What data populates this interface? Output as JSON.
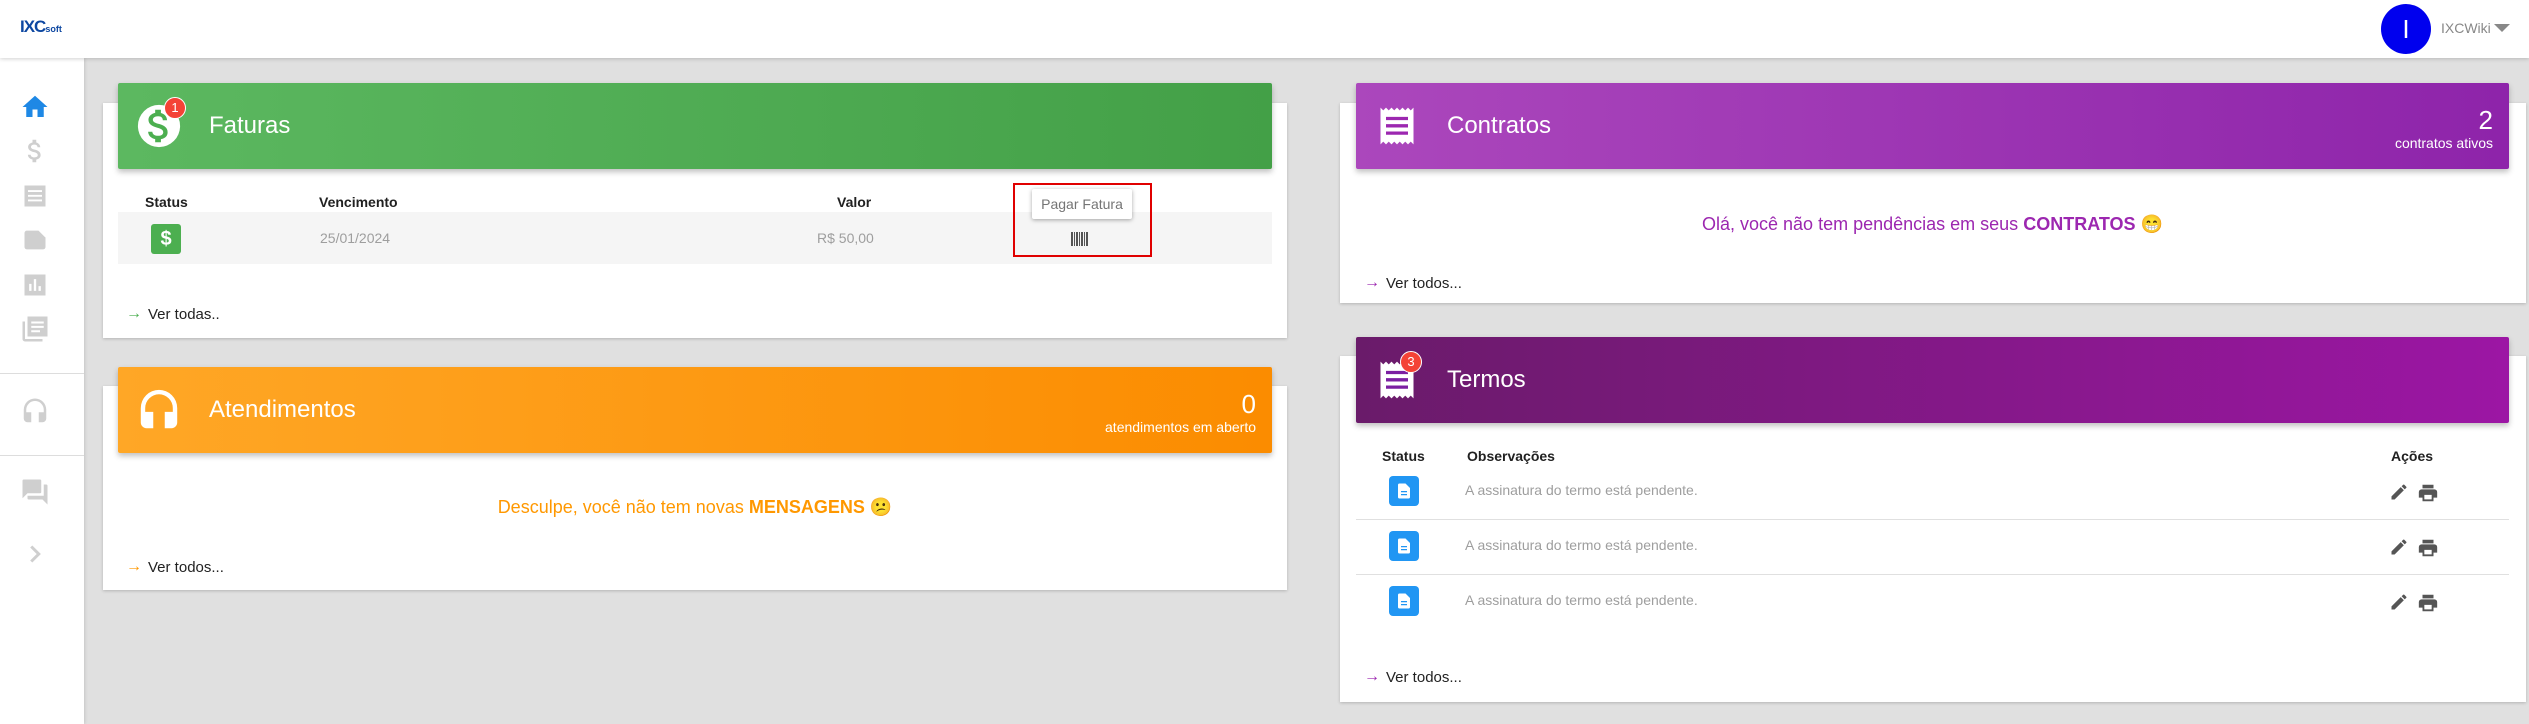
{
  "topbar": {
    "logo": "IXC",
    "logo_suffix": "soft",
    "avatar_initial": "I",
    "username": "IXCWiki"
  },
  "sidebar": {
    "items": [
      {
        "icon": "home-icon"
      },
      {
        "icon": "dollar-icon"
      },
      {
        "icon": "list-icon"
      },
      {
        "icon": "label-icon"
      },
      {
        "icon": "bar-chart-icon"
      },
      {
        "icon": "library-icon"
      },
      {
        "icon": "headset-icon"
      },
      {
        "icon": "forum-icon"
      },
      {
        "icon": "chevron-right-icon"
      }
    ]
  },
  "faturas": {
    "title": "Faturas",
    "badge": "1",
    "color": "#4caf50",
    "columns": {
      "status": "Status",
      "vencimento": "Vencimento",
      "valor": "Valor"
    },
    "rows": [
      {
        "vencimento": "25/01/2024",
        "valor": "R$ 50,00"
      }
    ],
    "tooltip": "Pagar Fatura",
    "see_all": "Ver todas.."
  },
  "atendimentos": {
    "title": "Atendimentos",
    "count": "0",
    "count_label": "atendimentos em aberto",
    "color": "#ff9800",
    "message_prefix": "Desculpe, você não tem novas",
    "message_bold": "MENSAGENS",
    "message_emoji": "😕",
    "see_all": "Ver todos..."
  },
  "contratos": {
    "title": "Contratos",
    "count": "2",
    "count_label": "contratos ativos",
    "color": "#9c27b0",
    "message_prefix": "Olá, você não tem pendências em seus",
    "message_bold": "CONTRATOS",
    "message_emoji": "😁",
    "see_all": "Ver todos..."
  },
  "termos": {
    "title": "Termos",
    "badge": "3",
    "color": "#7b1fa2",
    "columns": {
      "status": "Status",
      "observacoes": "Observações",
      "acoes": "Ações"
    },
    "rows": [
      {
        "observacao": "A assinatura do termo está pendente."
      },
      {
        "observacao": "A assinatura do termo está pendente."
      },
      {
        "observacao": "A assinatura do termo está pendente."
      }
    ],
    "see_all": "Ver todos..."
  }
}
